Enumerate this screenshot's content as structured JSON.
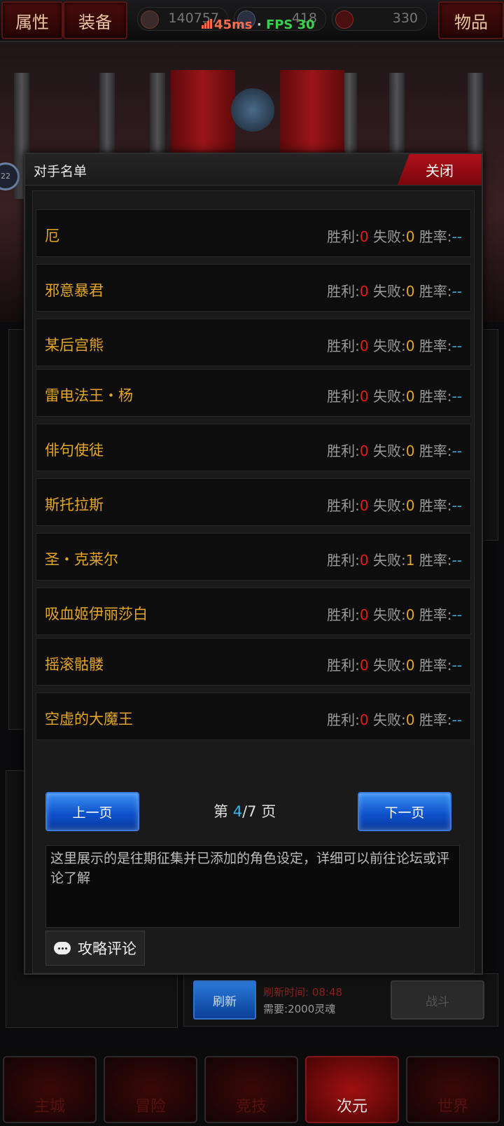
{
  "topbar": {
    "tab_attr": "属性",
    "tab_equip": "装备",
    "tab_items": "物品",
    "res1": "140757",
    "res2": "418",
    "res3": "330",
    "ping": "45ms",
    "separator": "·",
    "fps": "FPS 30"
  },
  "scene": {
    "side_badge": "22"
  },
  "modal": {
    "title": "对手名单",
    "close_label": "关闭",
    "labels": {
      "win": "胜利:",
      "lose": "失败:",
      "rate": "胜率:"
    },
    "rows": [
      {
        "name": "厄",
        "win": "0",
        "lose": "0",
        "rate": "--"
      },
      {
        "name": "邪意暴君",
        "win": "0",
        "lose": "0",
        "rate": "--"
      },
      {
        "name": "某后宫熊",
        "win": "0",
        "lose": "0",
        "rate": "--"
      },
      {
        "name": "雷电法王・杨",
        "win": "0",
        "lose": "0",
        "rate": "--"
      },
      {
        "name": "俳句使徒",
        "win": "0",
        "lose": "0",
        "rate": "--"
      },
      {
        "name": "斯托拉斯",
        "win": "0",
        "lose": "0",
        "rate": "--"
      },
      {
        "name": "圣・克莱尔",
        "win": "0",
        "lose": "1",
        "rate": "--"
      },
      {
        "name": "吸血姬伊丽莎白",
        "win": "0",
        "lose": "0",
        "rate": "--"
      },
      {
        "name": "摇滚骷髅",
        "win": "0",
        "lose": "0",
        "rate": "--"
      },
      {
        "name": "空虚的大魔王",
        "win": "0",
        "lose": "0",
        "rate": "--"
      }
    ],
    "prev_label": "上一页",
    "next_label": "下一页",
    "page_prefix": "第",
    "page_current": "4",
    "page_total": "/7",
    "page_suffix": "页",
    "note": "这里展示的是往期征集并已添加的角色设定，详细可以前往论坛或评论了解",
    "comment_label": "攻略评论"
  },
  "below": {
    "refresh_label": "刷新",
    "refresh_time_label": "刷新时间:",
    "refresh_time": "08:48",
    "need_label": "需要:",
    "need_value": "2000灵魂",
    "fight_label": "战斗"
  },
  "nav": [
    "主城",
    "冒险",
    "竞技",
    "次元",
    "世界"
  ]
}
